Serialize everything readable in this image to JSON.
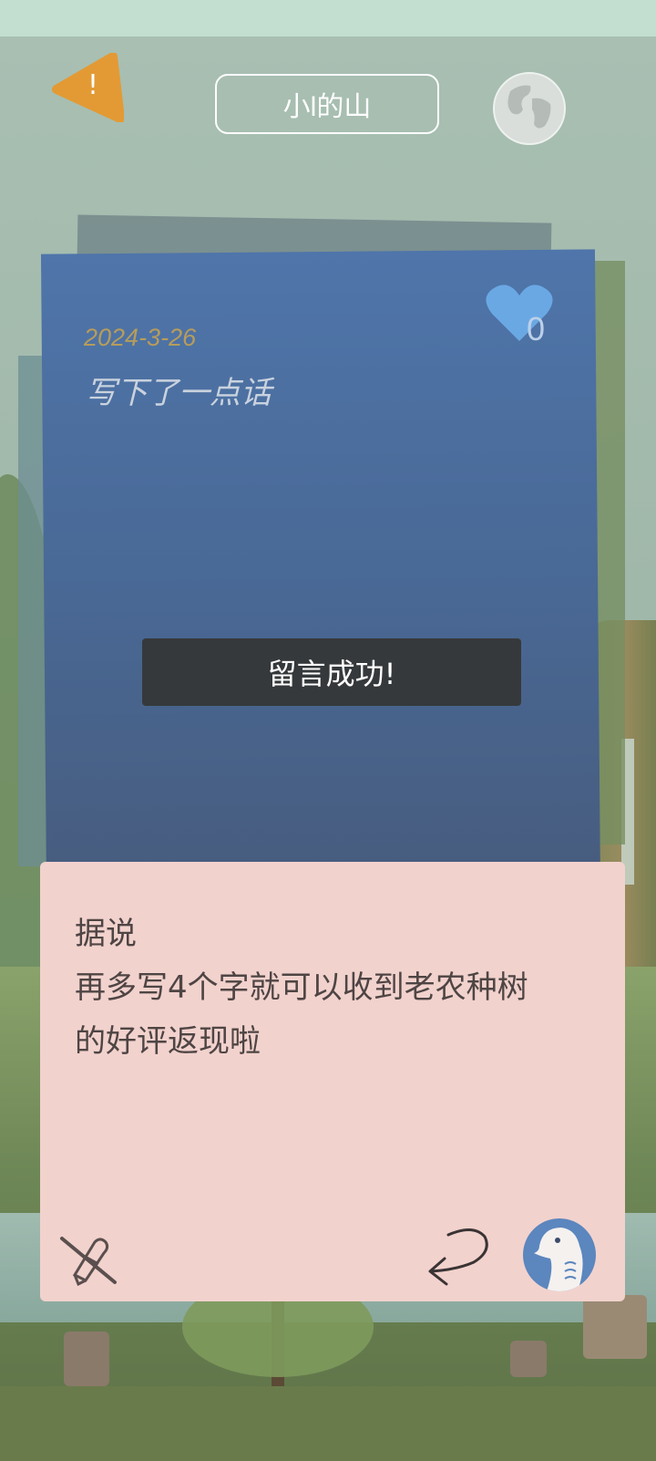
{
  "header": {
    "warning_symbol": "!",
    "title": "小l的山",
    "warning_color": "#e39a34",
    "globe_icon": "globe-icon"
  },
  "note": {
    "date": "2024-3-26",
    "text": "写下了一点话",
    "like_count": "0",
    "card_color": "#4f75aa",
    "heart_color": "#6aa8e4"
  },
  "toast": {
    "message": "留言成功!"
  },
  "tip_panel": {
    "lines": [
      "据说",
      "再多写4个字就可以收到老农种树",
      "的好评返现啦"
    ],
    "background": "#f2d2cd"
  },
  "actions": {
    "left_icon": "eraser-off-icon",
    "middle_icon": "back-arrow-icon",
    "right_icon": "bird-avatar-icon"
  }
}
